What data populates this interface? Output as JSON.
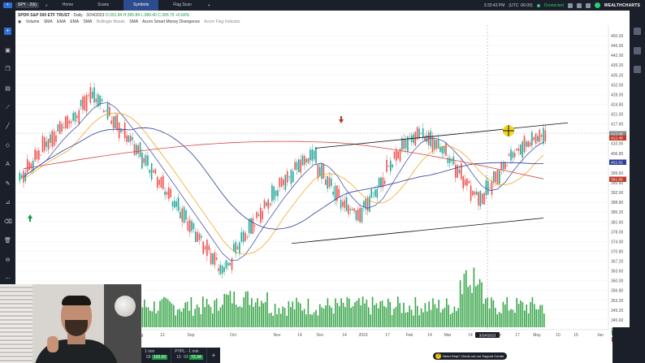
{
  "topbar": {
    "symbol": "SPY · 2(k)",
    "tabs": [
      "Home",
      "Scans",
      "Symbols",
      "Flag Scan"
    ],
    "active_tab": "Symbols",
    "add_tab": "+",
    "time": "3:33:43 PM",
    "timezone": "(UTC -06:00)",
    "connection": "Connected",
    "brand": "WEALTHCHARTS"
  },
  "legend": {
    "title": "SPDR S&P 500 ETF TRUST",
    "interval": "Daily",
    "date": "3/24/2023",
    "ohlc": "O:391.84 H:395.84 L:389.40 C:395.75 +0.66%",
    "indicators": [
      "Volume",
      "SMA",
      "EMA",
      "EMA",
      "SMA",
      "Bollinger Bands",
      "SMA",
      "Acorn Smart Money Divergence",
      "Acorn Flag Indicator"
    ]
  },
  "price_axis": {
    "ticks": [
      "450.00",
      "446.00",
      "442.00",
      "439.20",
      "435.20",
      "432.00",
      "428.00",
      "424.80",
      "421.00",
      "417.60",
      "413.00",
      "410.00",
      "406.80",
      "403.00",
      "399.60",
      "395.80",
      "392.00",
      "388.80",
      "385.20",
      "381.60",
      "378.00",
      "374.00",
      "370.80",
      "367.20",
      "363.60",
      "360.00",
      "356.80",
      "353.20",
      "349.20",
      "345.60",
      "342.00"
    ],
    "labels": [
      {
        "text": "413.08",
        "color": "#7f8c8d"
      },
      {
        "text": "412.48",
        "color": "#c0392b"
      },
      {
        "text": "402.62",
        "color": "#2c3e9c"
      },
      {
        "text": "391.65",
        "color": "#c0392b"
      }
    ],
    "bottom_labels": [
      {
        "text": "0.18",
        "color": "#1a9641"
      },
      {
        "text": "0.15",
        "color": "#c0392b"
      }
    ]
  },
  "time_axis": {
    "ticks": [
      "Aug",
      "12",
      "Sep",
      "Oct",
      "Nov",
      "14",
      "Dec",
      "14",
      "2023",
      "17",
      "Feb",
      "14",
      "Mar",
      "14",
      "3/24/2023",
      "pr",
      "17",
      "May",
      "10",
      "15",
      "Jun",
      "14"
    ]
  },
  "crosshair_date": "3/24/2023",
  "minitabs": [
    {
      "title": "1 min",
      "price": "102.50",
      "sub": "03"
    },
    {
      "title": "PYPL - 1 min",
      "price": "72.34",
      "sub": "15",
      "sub2": "03"
    }
  ],
  "minitabs_add": "+",
  "support_text": "Need Help? Check out our Support Center",
  "colors": {
    "up": "#26a69a",
    "down": "#ef5350",
    "volume": "#3aa64b",
    "sma_blue": "#2c3e9c",
    "sma_red": "#d64541",
    "ema_orange": "#f39c12",
    "channel": "#111111"
  },
  "chart_data": {
    "type": "candlestick",
    "symbol": "SPY",
    "interval": "Daily",
    "close_series_approx": [
      398,
      402,
      406,
      410,
      412,
      416,
      418,
      420,
      425,
      428,
      426,
      422,
      418,
      415,
      412,
      408,
      404,
      400,
      396,
      392,
      388,
      384,
      380,
      376,
      372,
      368,
      364,
      366,
      372,
      376,
      380,
      384,
      388,
      392,
      396,
      398,
      402,
      404,
      406,
      400,
      396,
      392,
      388,
      386,
      384,
      388,
      392,
      396,
      402,
      406,
      410,
      412,
      414,
      412,
      410,
      408,
      404,
      400,
      396,
      392,
      390,
      394,
      398,
      402,
      406,
      408,
      410,
      412,
      413
    ],
    "channel_top": {
      "start_price": 408.5,
      "end_price": 417.8
    },
    "channel_bottom": {
      "start_price": 373.6,
      "end_price": 382.9
    }
  }
}
